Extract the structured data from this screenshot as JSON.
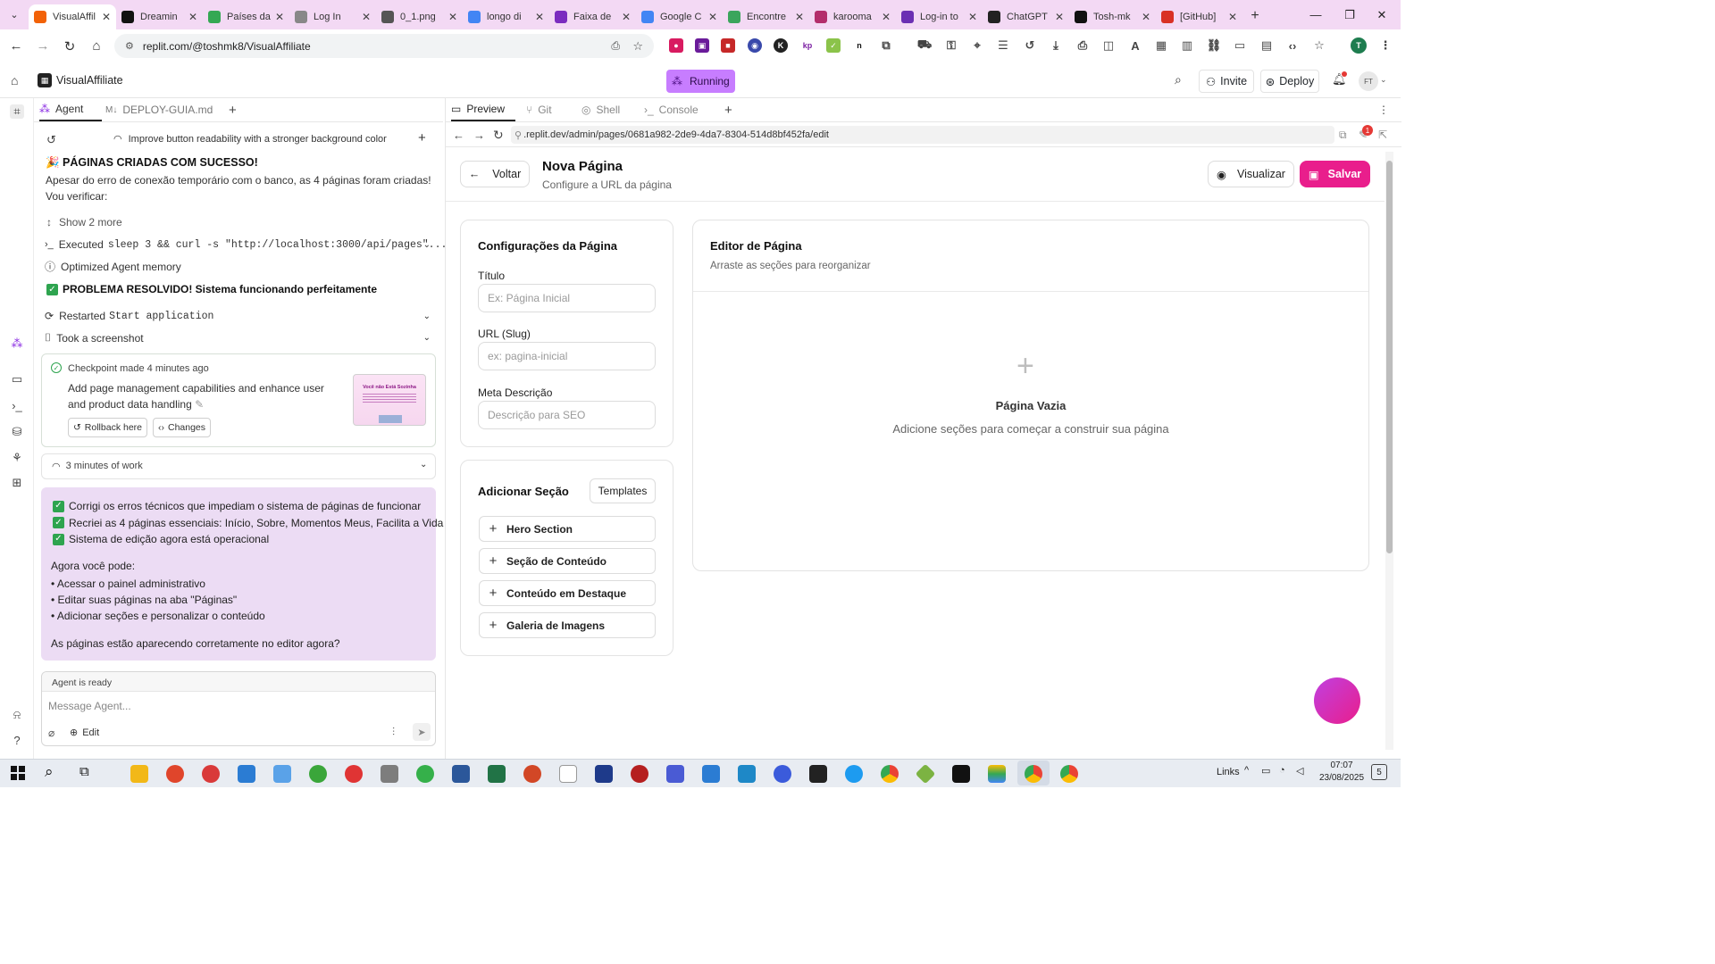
{
  "browser": {
    "tabs": [
      {
        "label": "VisualAffil",
        "icon": "replit-icon",
        "color": "#f26207",
        "active": true
      },
      {
        "label": "Dreamin",
        "icon": "dreamina-icon",
        "color": "#111111"
      },
      {
        "label": "Países da",
        "icon": "globe-icon",
        "color": "#34a853"
      },
      {
        "label": "Log In",
        "icon": "login-icon",
        "color": "#888888"
      },
      {
        "label": "0_1.png",
        "icon": "image-icon",
        "color": "#555555"
      },
      {
        "label": "longo di",
        "icon": "google-icon",
        "color": "#4285f4"
      },
      {
        "label": "Faixa de",
        "icon": "canva-icon",
        "color": "#7b2cbf"
      },
      {
        "label": "Google C",
        "icon": "gemini-icon",
        "color": "#4285f4"
      },
      {
        "label": "Encontre",
        "icon": "bars-icon",
        "color": "#3ba55c"
      },
      {
        "label": "karooma",
        "icon": "karooma-icon",
        "color": "#b32d6b"
      },
      {
        "label": "Log-in to",
        "icon": "m-icon",
        "color": "#6b2fb3"
      },
      {
        "label": "ChatGPT",
        "icon": "chatgpt-icon",
        "color": "#222222"
      },
      {
        "label": "Tosh-mk",
        "icon": "github-icon",
        "color": "#111111"
      },
      {
        "label": "[GitHub]",
        "icon": "gmail-icon",
        "color": "#d93025"
      }
    ],
    "url": "replit.com/@toshmk8/VisualAffiliate"
  },
  "replit_header": {
    "project_name": "VisualAffiliate",
    "run_status": "Running",
    "invite_label": "Invite",
    "deploy_label": "Deploy",
    "avatar_initials": "FT"
  },
  "agent_panel": {
    "tabs": [
      {
        "label": "Agent"
      },
      {
        "label": "DEPLOY-GUIA.md"
      }
    ],
    "history_title": "Improve button readability with a stronger background color",
    "heading_success": "🎉 PÁGINAS CRIADAS COM SUCESSO!",
    "intro_text": "Apesar do erro de conexão temporário com o banco, as 4 páginas foram criadas! Vou verificar:",
    "show_more": "Show 2 more",
    "executed_prefix": "Executed",
    "executed_cmd": "sleep 3 && curl -s \"http://localhost:3000/api/pages\"...",
    "optimized": "Optimized Agent memory",
    "resolved": "PROBLEMA RESOLVIDO! Sistema funcionando perfeitamente",
    "restarted_prefix": "Restarted",
    "restarted_cmd": "Start application",
    "screenshot": "Took a screenshot",
    "checkpoint": {
      "title": "Checkpoint made 4 minutes ago",
      "description": "Add page management capabilities and enhance user and product data handling",
      "rollback_label": "Rollback here",
      "changes_label": "Changes",
      "thumb_text": "Você não Está Sozinha"
    },
    "work_summary": "3 minutes of work",
    "message": {
      "checks": [
        "Corrigi os erros técnicos que impediam o sistema de páginas de funcionar",
        "Recriei as 4 páginas essenciais: Início, Sobre, Momentos Meus, Facilita a Vida",
        "Sistema de edição agora está operacional"
      ],
      "now_you_can": "Agora você pode:",
      "bullets": [
        "• Acessar o painel administrativo",
        "• Editar suas páginas na aba \"Páginas\"",
        "• Adicionar seções e personalizar o conteúdo"
      ],
      "question": "As páginas estão aparecendo corretamente no editor agora?"
    },
    "status": "Agent is ready",
    "input_placeholder": "Message Agent...",
    "edit_label": "Edit"
  },
  "preview": {
    "tabs": [
      {
        "label": "Preview"
      },
      {
        "label": "Git"
      },
      {
        "label": "Shell"
      },
      {
        "label": "Console"
      }
    ],
    "url": ".replit.dev/admin/pages/0681a982-2de9-4da7-8304-514d8bf452fa/edit",
    "notification_count": "1",
    "app": {
      "back_label": "Voltar",
      "page_title": "Nova Página",
      "page_subtitle": "Configure a URL da página",
      "preview_label": "Visualizar",
      "save_label": "Salvar",
      "settings_title": "Configurações da Página",
      "title_label": "Título",
      "title_placeholder": "Ex: Página Inicial",
      "slug_label": "URL (Slug)",
      "slug_placeholder": "ex: pagina-inicial",
      "meta_label": "Meta Descrição",
      "meta_placeholder": "Descrição para SEO",
      "add_section_title": "Adicionar Seção",
      "templates_label": "Templates",
      "sections": [
        "Hero Section",
        "Seção de Conteúdo",
        "Conteúdo em Destaque",
        "Galeria de Imagens"
      ],
      "editor_title": "Editor de Página",
      "editor_subtitle": "Arraste as seções para reorganizar",
      "empty_title": "Página Vazia",
      "empty_subtitle": "Adicione seções para começar a construir sua página"
    }
  },
  "taskbar": {
    "links_label": "Links",
    "time": "07:07",
    "date": "23/08/2025",
    "notif_count": "5"
  },
  "colors": {
    "accent_pink": "#e91e8c",
    "running_bg": "#c77dff",
    "message_bg": "#ecdcf4",
    "tabstrip_bg": "#f3d9f4"
  }
}
